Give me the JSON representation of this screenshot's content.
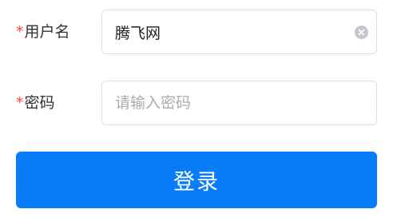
{
  "colors": {
    "required_mark": "#f04a4a",
    "primary": "#0a7cf8",
    "border": "#dcdfe6",
    "placeholder": "#a8abb2"
  },
  "form": {
    "username": {
      "required_mark": "*",
      "label": "用户名",
      "value": "腾飞网",
      "clear_icon": "circle-x-icon"
    },
    "password": {
      "required_mark": "*",
      "label": "密码",
      "value": "",
      "placeholder": "请输入密码"
    },
    "submit_label": "登录"
  }
}
